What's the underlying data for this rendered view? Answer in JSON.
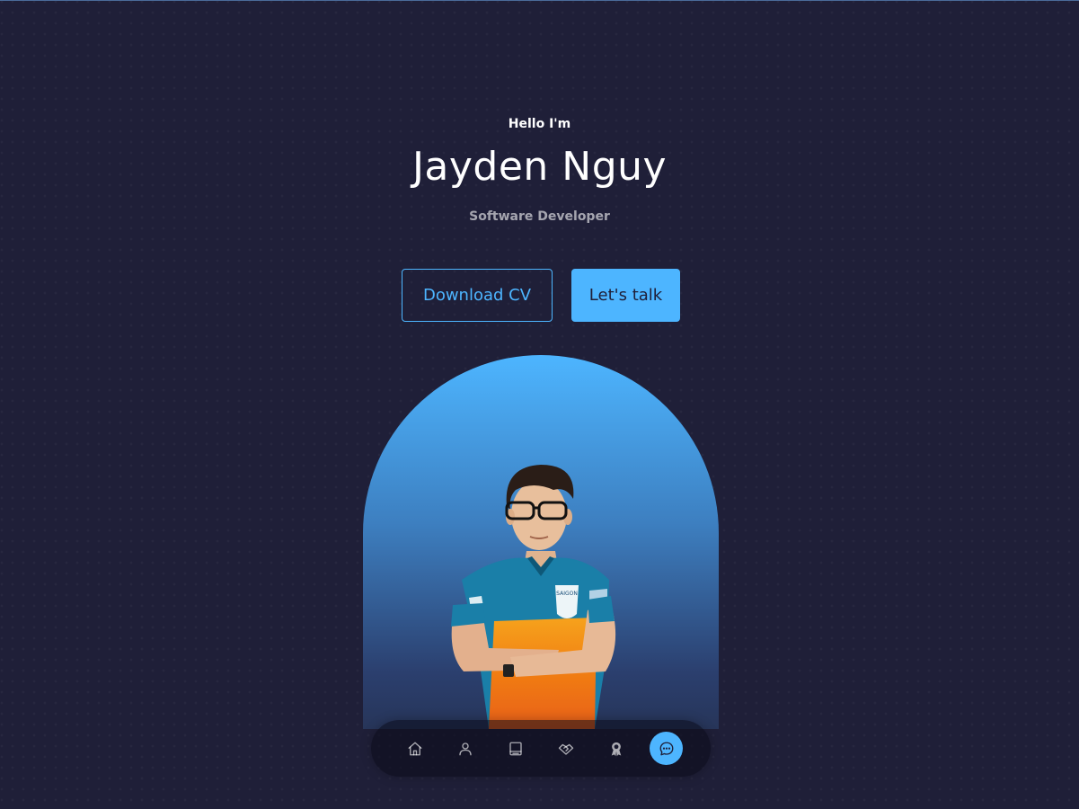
{
  "hero": {
    "greeting": "Hello I'm",
    "name": "Jayden Nguy",
    "role": "Software Developer"
  },
  "buttons": {
    "download_cv_label": "Download CV",
    "lets_talk_label": "Let's talk"
  },
  "portrait": {
    "jersey_text": "SAIGON"
  },
  "nav": {
    "items": [
      {
        "icon": "home-icon",
        "active": false
      },
      {
        "icon": "user-icon",
        "active": false
      },
      {
        "icon": "book-icon",
        "active": false
      },
      {
        "icon": "handshake-icon",
        "active": false
      },
      {
        "icon": "award-icon",
        "active": false
      },
      {
        "icon": "chat-icon",
        "active": true
      }
    ]
  },
  "colors": {
    "background": "#1f1f38",
    "accent": "#4db5ff",
    "text": "#ffffff",
    "muted_text": "rgba(255,255,255,0.6)"
  }
}
